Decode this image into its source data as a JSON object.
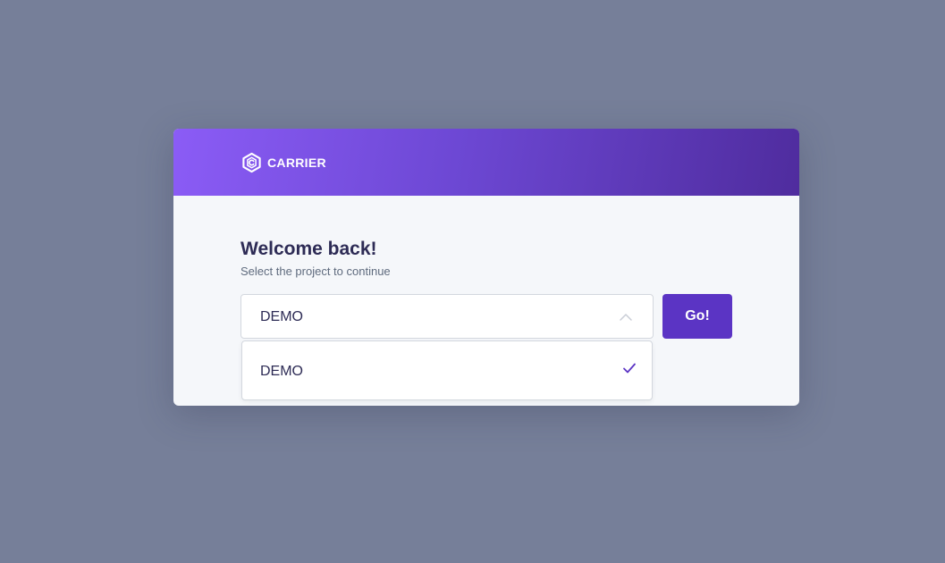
{
  "header": {
    "logo_icon": "carrier-hexagon-icon",
    "brand": "CARRIER",
    "gradient_start": "#8b5cf6",
    "gradient_end": "#4f2c9e"
  },
  "welcome": {
    "title": "Welcome back!",
    "subtitle": "Select the project to continue"
  },
  "project_select": {
    "selected_value": "DEMO",
    "expanded": true,
    "options": [
      {
        "label": "DEMO",
        "selected": true
      }
    ]
  },
  "go_button": {
    "label": "Go!",
    "color": "#5b34c4"
  },
  "colors": {
    "background": "#767f99",
    "text_primary": "#2d2b55",
    "text_secondary": "#5f6b7e"
  }
}
